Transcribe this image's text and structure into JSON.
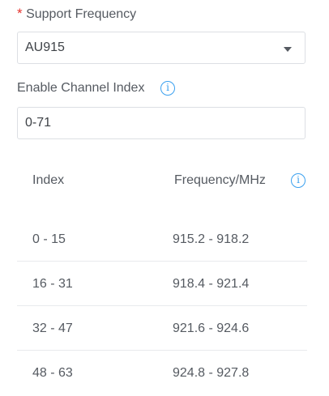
{
  "support_frequency": {
    "required_mark": "*",
    "label": "Support Frequency",
    "selected": "AU915"
  },
  "channel_index": {
    "label": "Enable Channel Index",
    "value": "0-71"
  },
  "table": {
    "headers": [
      "Index",
      "Frequency/MHz"
    ],
    "rows": [
      {
        "index": "0 - 15",
        "frequency": "915.2 - 918.2"
      },
      {
        "index": "16 - 31",
        "frequency": "918.4 - 921.4"
      },
      {
        "index": "32 - 47",
        "frequency": "921.6 - 924.6"
      },
      {
        "index": "48 - 63",
        "frequency": "924.8 - 927.8"
      }
    ]
  },
  "icons": {
    "info": "i"
  },
  "colors": {
    "required": "#e5322d",
    "info_accent": "#3aa0ef",
    "text": "#555a61",
    "border": "#dcdfe4"
  }
}
